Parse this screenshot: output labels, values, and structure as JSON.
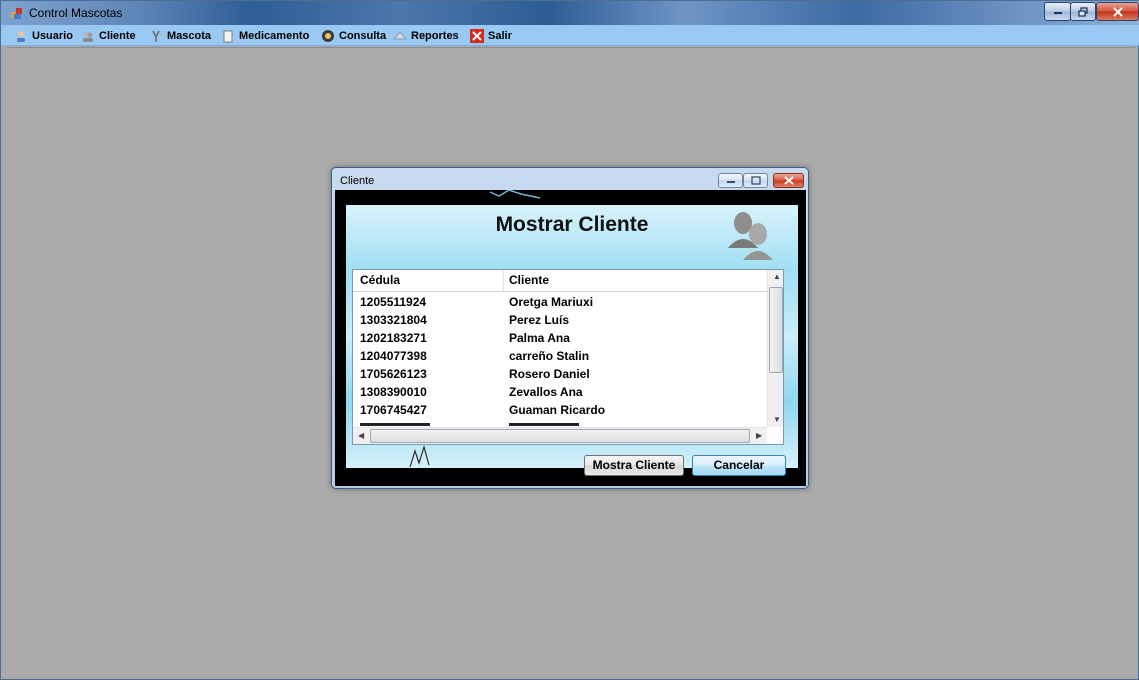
{
  "app": {
    "title": "Control Mascotas"
  },
  "menu": {
    "items": [
      {
        "label": "Usuario",
        "icon": "user-icon"
      },
      {
        "label": "Cliente",
        "icon": "clients-icon"
      },
      {
        "label": "Mascota",
        "icon": "pet-icon"
      },
      {
        "label": "Medicamento",
        "icon": "medicine-icon"
      },
      {
        "label": "Consulta",
        "icon": "consult-icon"
      },
      {
        "label": "Reportes",
        "icon": "reports-icon"
      },
      {
        "label": "Salir",
        "icon": "exit-icon"
      }
    ]
  },
  "dialog": {
    "title": "Cliente",
    "heading": "Mostrar Cliente",
    "columns": [
      "Cédula",
      "Cliente"
    ],
    "rows": [
      [
        "1205511924",
        "Oretga Mariuxi"
      ],
      [
        "1303321804",
        "Perez Luís"
      ],
      [
        "1202183271",
        "Palma Ana"
      ],
      [
        "1204077398",
        "carreño Stalin"
      ],
      [
        "1705626123",
        "Rosero Daniel"
      ],
      [
        "1308390010",
        "Zevallos Ana"
      ],
      [
        "1706745427",
        "Guaman Ricardo"
      ]
    ],
    "buttons": {
      "show": "Mostra Cliente",
      "cancel": "Cancelar"
    }
  },
  "colors": {
    "menubar": "#99c8f3",
    "workspace": "#ababab",
    "close_button": "#c2341b"
  }
}
